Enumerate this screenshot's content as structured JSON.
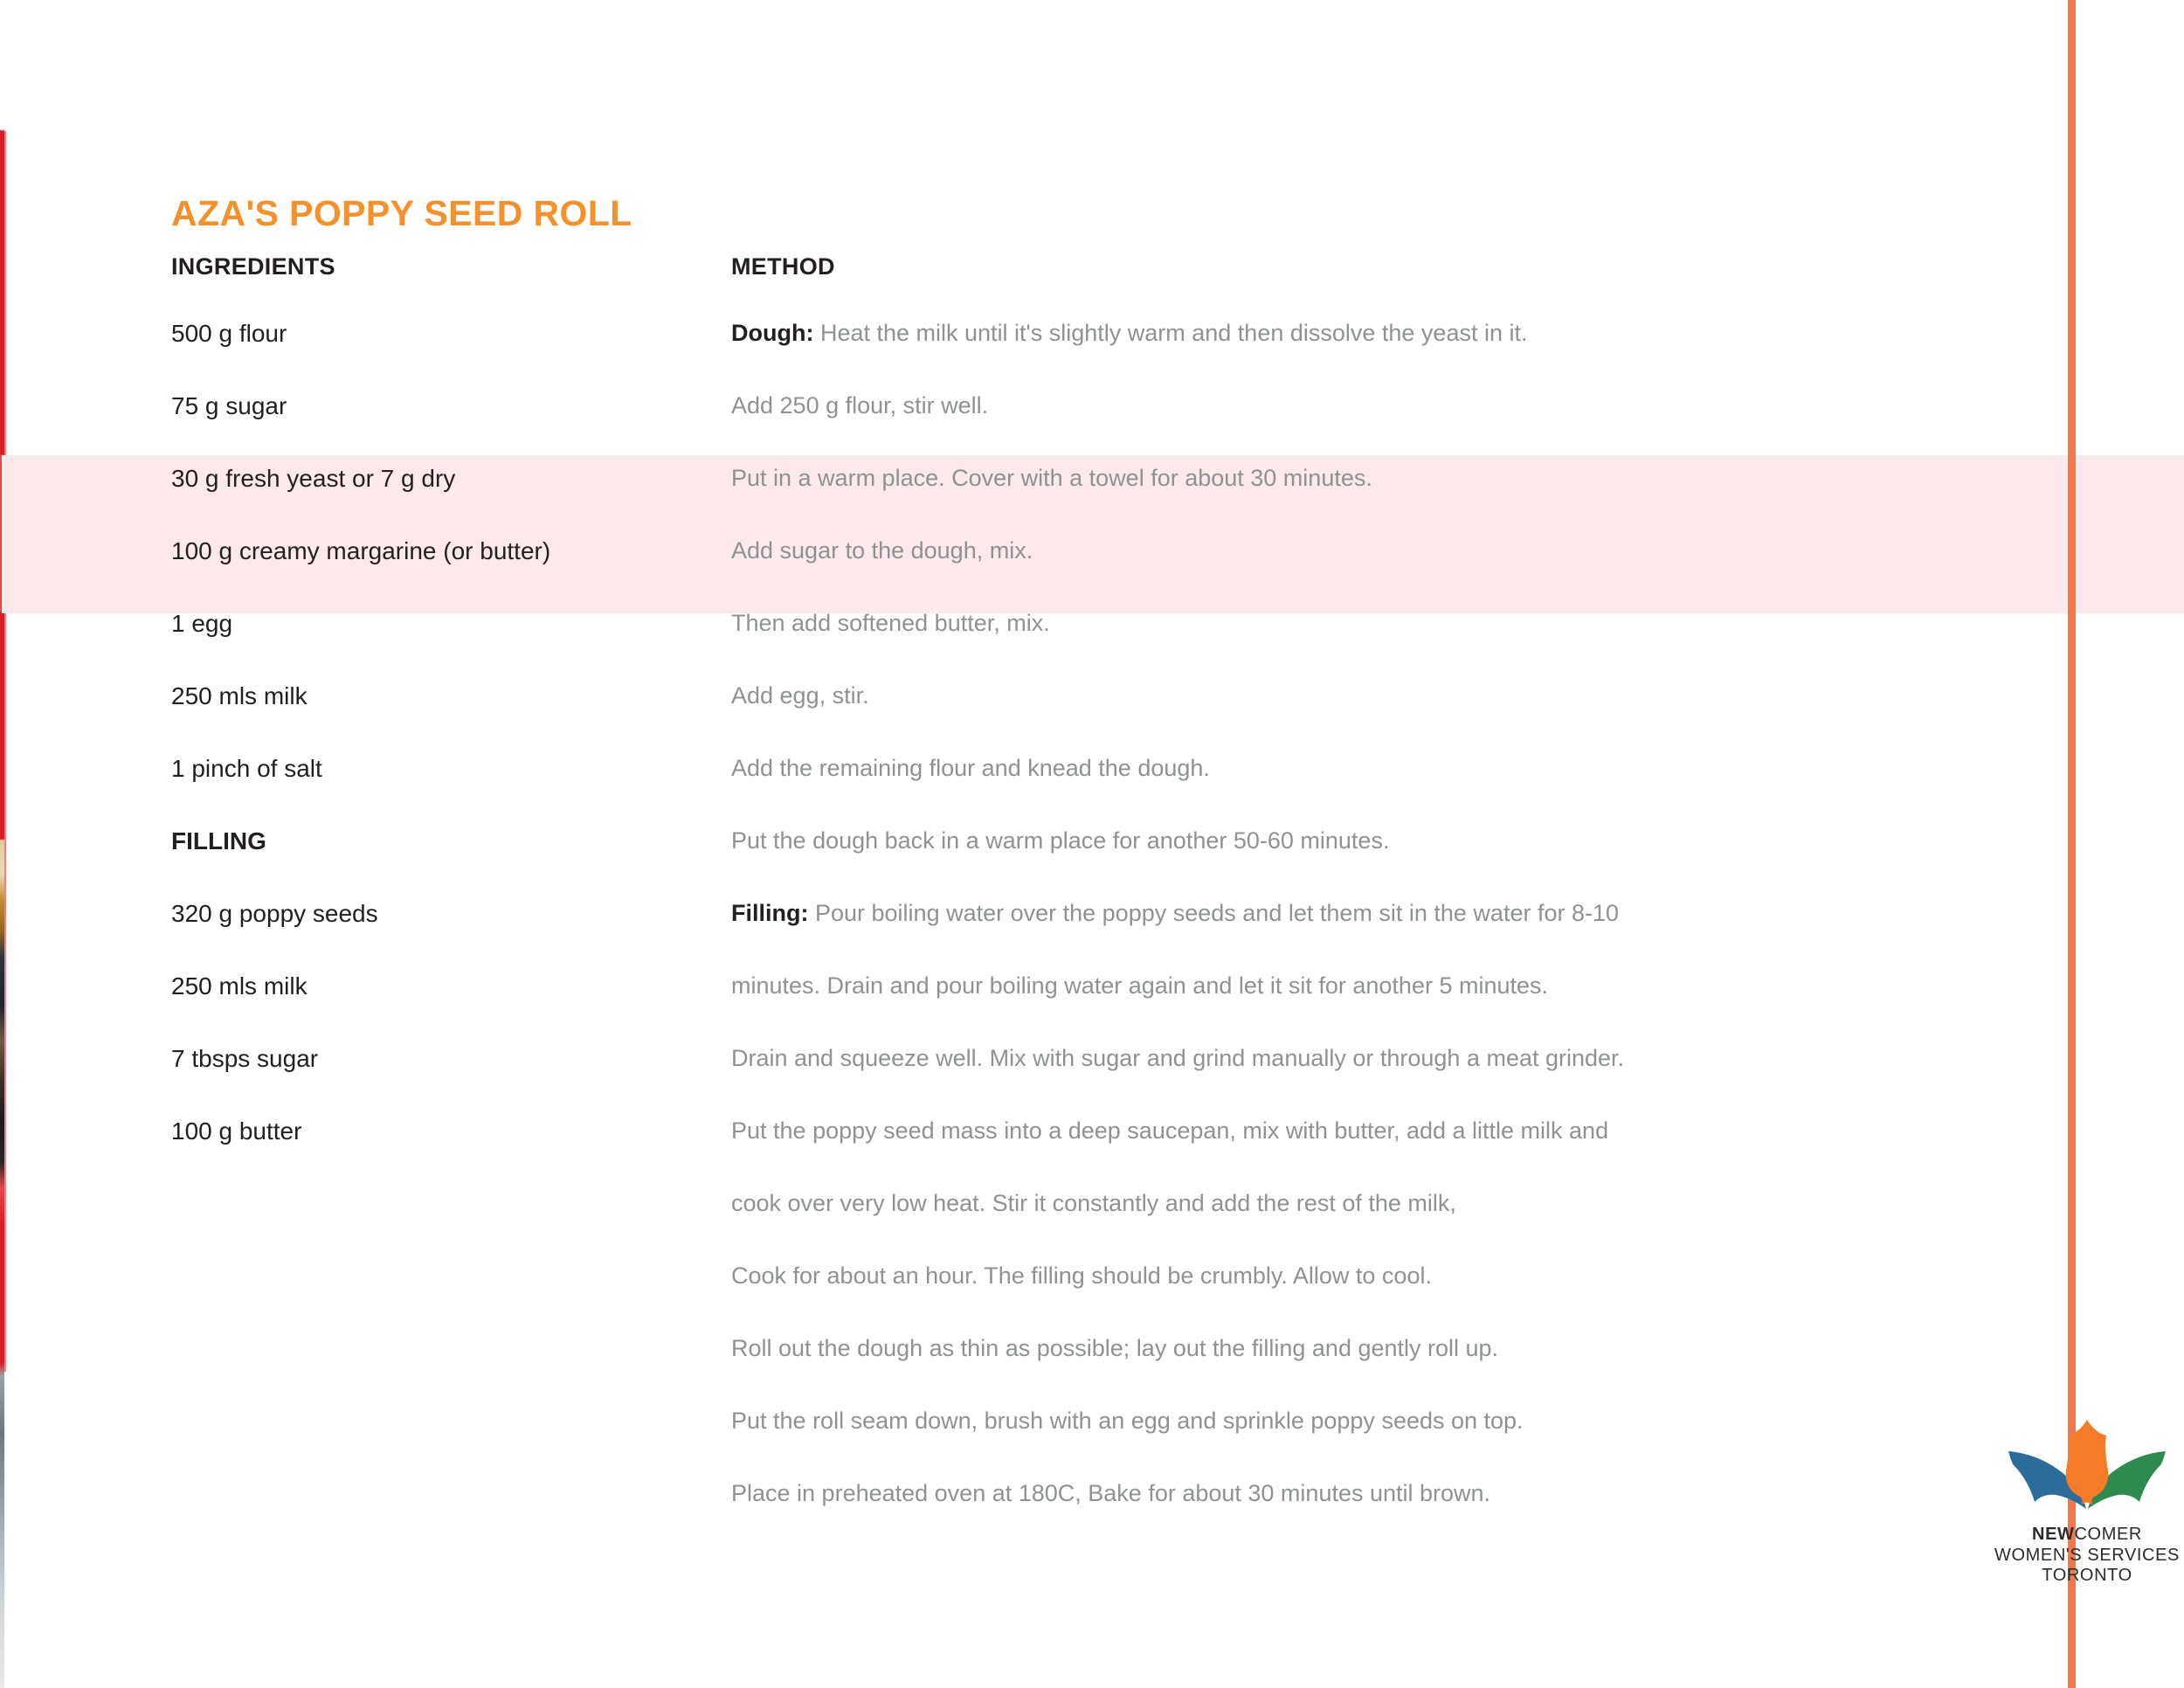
{
  "document": {
    "title": "AZA'S POPPY SEED ROLL",
    "accent_color": "#f3912c",
    "rule_color": "#f2784b",
    "highlight_color": "#fce9ec"
  },
  "columns": {
    "ingredients_header": "INGREDIENTS",
    "method_header": "METHOD"
  },
  "ingredients": [
    {
      "text": "500 g flour",
      "section": false
    },
    {
      "text": "75 g sugar",
      "section": false
    },
    {
      "text": "30 g fresh yeast or 7 g dry",
      "section": false
    },
    {
      "text": "100 g creamy margarine (or butter)",
      "section": false
    },
    {
      "text": "1 egg",
      "section": false
    },
    {
      "text": "250 mls milk",
      "section": false
    },
    {
      "text": "1 pinch of salt",
      "section": false
    },
    {
      "text": "FILLING",
      "section": true
    },
    {
      "text": "320 g poppy seeds",
      "section": false
    },
    {
      "text": "250 mls milk",
      "section": false
    },
    {
      "text": "7 tbsps sugar",
      "section": false
    },
    {
      "text": "100 g butter",
      "section": false
    }
  ],
  "method": [
    {
      "lead": "Dough:",
      "text": "Heat the milk until it's slightly warm and then dissolve the yeast in it."
    },
    {
      "lead": "",
      "text": "Add 250 g flour, stir well."
    },
    {
      "lead": "",
      "text": "Put in a warm place. Cover with a towel for about 30 minutes."
    },
    {
      "lead": "",
      "text": "Add sugar to the dough, mix."
    },
    {
      "lead": "",
      "text": "Then add softened butter, mix."
    },
    {
      "lead": "",
      "text": "Add egg, stir."
    },
    {
      "lead": "",
      "text": "Add the remaining flour and knead the dough."
    },
    {
      "lead": "",
      "text": "Put the dough back in a warm place for another 50-60 minutes."
    },
    {
      "lead": "Filling:",
      "text": "Pour boiling water over the poppy seeds and let them sit in the water for 8-10"
    },
    {
      "lead": "",
      "text": "minutes. Drain and pour boiling water again and let it sit for another 5 minutes."
    },
    {
      "lead": "",
      "text": "Drain and squeeze well. Mix with sugar and grind manually or through a meat grinder."
    },
    {
      "lead": "",
      "text": "Put the poppy seed mass into a deep saucepan, mix with butter, add a little milk and"
    },
    {
      "lead": "",
      "text": "cook over very low heat. Stir it constantly and add the rest of the milk,"
    },
    {
      "lead": "",
      "text": "Cook for about an hour. The filling should be crumbly. Allow to cool."
    },
    {
      "lead": "",
      "text": "Roll out the dough as thin as possible; lay out the filling and gently roll up."
    },
    {
      "lead": "",
      "text": "Put the roll seam down, brush with an egg and sprinkle poppy seeds on top."
    },
    {
      "lead": "",
      "text": "Place in preheated oven at 180C, Bake for about 30 minutes until brown."
    }
  ],
  "logo": {
    "line1_bold": "NEW",
    "line1_rest": "COMER",
    "line2": "WOMEN'S SERVICES",
    "line3": "TORONTO",
    "petal_color": "#f47b28",
    "leaf_left_color": "#2b6c9b",
    "leaf_right_color": "#2e8a4e"
  }
}
